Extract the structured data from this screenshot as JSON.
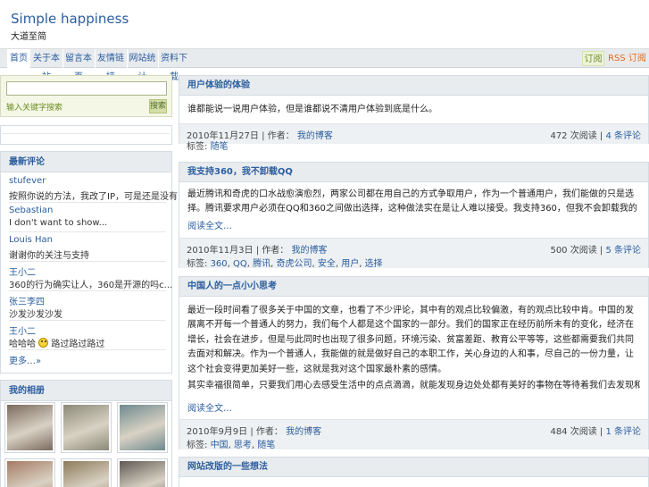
{
  "header": {
    "title": "Simple happiness",
    "description": "大道至简"
  },
  "nav": {
    "tabs": [
      "首页",
      "关于本站",
      "留言本页",
      "友情链接",
      "网站统计",
      "资料下载"
    ],
    "feedback": "订阅",
    "rss": "RSS 订阅"
  },
  "search": {
    "label": "输入关键字搜索",
    "button": "搜索",
    "placeholder": ""
  },
  "comments": {
    "title": "最新评论",
    "items": [
      {
        "author": "stufever",
        "text": "按照你说的方法，我改了IP，可是还是没有…"
      },
      {
        "author": "Sebastian",
        "text": "I don't want to show..."
      },
      {
        "author": "Louis Han",
        "text": "谢谢你的关注与支持"
      },
      {
        "author": "王小二",
        "text": "360的行为确实让人，360是开源的吗c..."
      },
      {
        "author": "张三李四",
        "text": "沙发沙发沙发"
      },
      {
        "author": "王小二",
        "text_before": "哈哈哈",
        "text_after": "路过路过路过"
      }
    ],
    "more": "更多…»"
  },
  "photos": {
    "title": "我的相册",
    "items": [
      {
        "alt": "photo-1",
        "color": "#7a6a5e"
      },
      {
        "alt": "photo-2",
        "color": "#8a8a78"
      },
      {
        "alt": "photo-3",
        "color": "#6f8a8f"
      },
      {
        "alt": "photo-4",
        "color": "#a57a63"
      },
      {
        "alt": "photo-5",
        "color": "#8d7b5b"
      },
      {
        "alt": "photo-6",
        "color": "#5f5a54"
      }
    ]
  },
  "posts": [
    {
      "title": "用户体验的体验",
      "body": "谁都能说一说用户体验，但是谁都说不清用户体验到底是什么。",
      "date": "2010年11月27日",
      "author_label": "| 作者：",
      "author": "我的博客",
      "views": "472 次阅读",
      "comments": "4 条评论",
      "tags_label": "标签:",
      "tags": [
        "随笔"
      ]
    },
    {
      "title": "我支持360，我不卸载QQ",
      "body": "最近腾讯和奇虎的口水战愈演愈烈，两家公司都在用自己的方式争取用户，作为一个普通用户，我们能做的只是选择。腾讯要求用户必须在QQ和360之间做出选择，这种做法实在是让人难以接受。我支持360，但我不会卸载我的QQ。",
      "read_more": "阅读全文…",
      "date": "2010年11月3日",
      "author_label": "| 作者：",
      "author": "我的博客",
      "views": "500 次阅读",
      "comments": "5 条评论",
      "tags_label": "标签:",
      "tags": [
        "360",
        "QQ",
        "腾讯",
        "奇虎公司",
        "安全",
        "用户",
        "选择"
      ]
    },
    {
      "title": "中国人的一点小小思考",
      "body": "最近一段时间看了很多关于中国的文章，也看了不少评论，其中有的观点比较偏激，有的观点比较中肯。中国的发展离不开每一个普通人的努力，我们每个人都是这个国家的一部分。我们的国家正在经历前所未有的变化，经济在增长，社会在进步，但是与此同时也出现了很多问题，环境污染、贫富差距、教育公平等等，这些都需要我们共同去面对和解决。作为一个普通人，我能做的就是做好自己的本职工作，关心身边的人和事，尽自己的一份力量，让这个社会变得更加美好一些，这就是我对这个国家最朴素的感情。",
      "body2": "其实幸福很简单，只要我们用心去感受生活中的点点滴滴，就能发现身边处处都有美好的事物在等待着我们去发现和珍惜。",
      "read_more": "阅读全文…",
      "date": "2010年9月9日",
      "author_label": "| 作者：",
      "author": "我的博客",
      "views": "484 次阅读",
      "comments": "1 条评论",
      "tags_label": "标签:",
      "tags": [
        "中国",
        "思考",
        "随笔"
      ]
    },
    {
      "title": "网站改版的一些想法"
    }
  ]
}
